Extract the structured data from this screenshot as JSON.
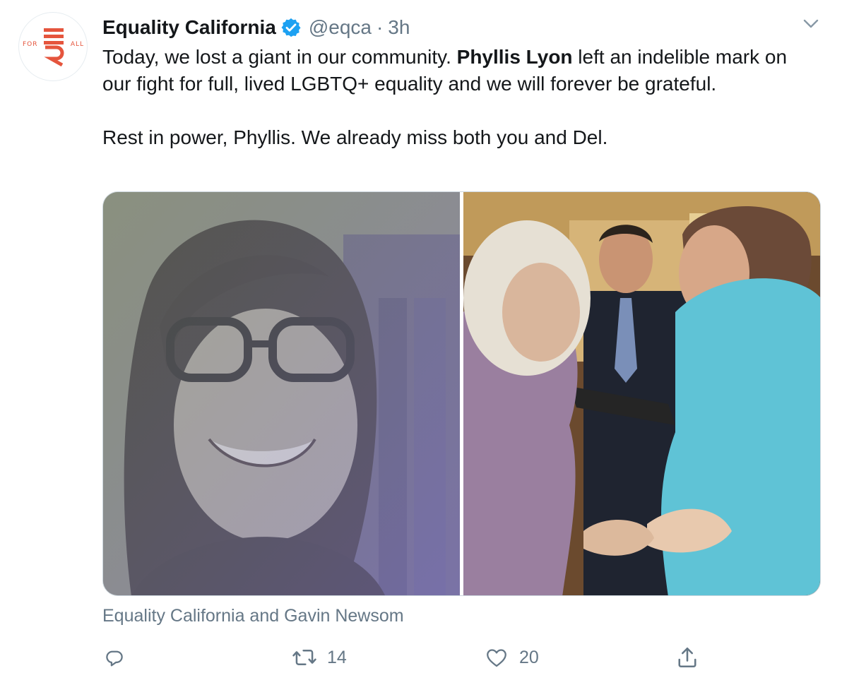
{
  "account": {
    "name": "Equality California",
    "handle": "@eqca",
    "separator": "·",
    "time": "3h",
    "avatar_left_text": "FOR",
    "avatar_right_text": "ALL",
    "brand_color": "#e5553d",
    "verified_color": "#1da1f2"
  },
  "tweet": {
    "line1_before": "Today, we lost a giant in our community. ",
    "line1_bold": "Phyllis Lyon",
    "line1_after": " left an indelible mark on our fight for full, lived LGBTQ+ equality and we will forever be grateful.",
    "paragraph2": "Rest in power, Phyllis. We already miss both you and Del."
  },
  "media": {
    "attribution": "Equality California and Gavin Newsom"
  },
  "actions": {
    "replies_icon": "reply-icon",
    "retweets_icon": "retweet-icon",
    "retweets": "14",
    "likes_icon": "heart-icon",
    "likes": "20",
    "share_icon": "share-icon"
  },
  "colors": {
    "text": "#14171a",
    "secondary": "#657786",
    "border": "#ccd6dd"
  }
}
